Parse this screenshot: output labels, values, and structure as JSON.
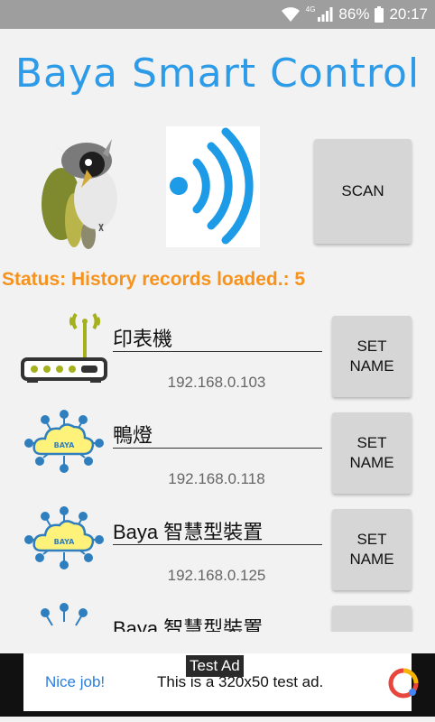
{
  "statusbar": {
    "battery": "86%",
    "time": "20:17",
    "network": "4G"
  },
  "app": {
    "title": "Baya Smart Control"
  },
  "controls": {
    "scan_label": "SCAN"
  },
  "status": {
    "text": "Status: History records loaded.: 5"
  },
  "devices": [
    {
      "name": "印表機",
      "ip": "192.168.0.103",
      "icon": "router-icon",
      "set_label_1": "SET",
      "set_label_2": "NAME"
    },
    {
      "name": "鴨燈",
      "ip": "192.168.0.118",
      "icon": "baya-cloud-icon",
      "set_label_1": "SET",
      "set_label_2": "NAME"
    },
    {
      "name": "Baya 智慧型裝置",
      "ip": "192.168.0.125",
      "icon": "baya-cloud-icon",
      "set_label_1": "SET",
      "set_label_2": "NAME"
    },
    {
      "name": "Baya 智慧型裝置",
      "ip": "",
      "icon": "baya-cloud-icon",
      "set_label_1": "",
      "set_label_2": ""
    }
  ],
  "ad": {
    "label": "Test Ad",
    "nice": "Nice job!",
    "text": "This is a 320x50 test ad.",
    "cloud_text": "BAYA"
  },
  "colors": {
    "accent": "#2d9be8",
    "status": "#f5931e",
    "button": "#d6d6d6"
  }
}
